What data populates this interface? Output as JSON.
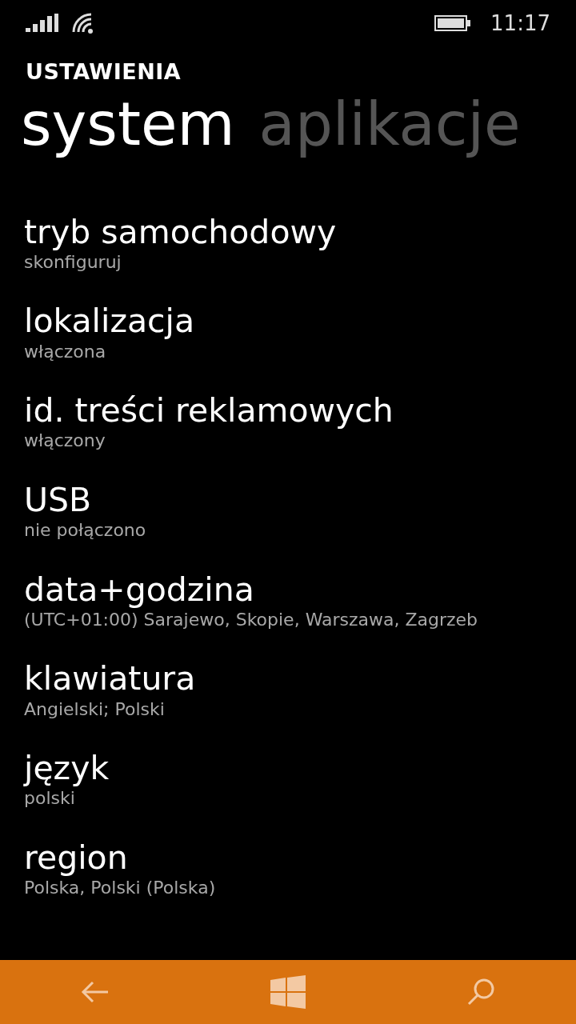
{
  "status_bar": {
    "time": "11:17"
  },
  "app_title": "USTAWIENIA",
  "pivots": [
    {
      "label": "system",
      "selected": true
    },
    {
      "label": "aplikacje",
      "selected": false
    }
  ],
  "settings": [
    {
      "title": "tryb samochodowy",
      "subtitle": "skonfiguruj"
    },
    {
      "title": "lokalizacja",
      "subtitle": "włączona"
    },
    {
      "title": "id. treści reklamowych",
      "subtitle": "włączony"
    },
    {
      "title": "USB",
      "subtitle": "nie połączono"
    },
    {
      "title": "data+godzina",
      "subtitle": "(UTC+01:00) Sarajewo, Skopie, Warszawa, Zagrzeb"
    },
    {
      "title": "klawiatura",
      "subtitle": "Angielski; Polski"
    },
    {
      "title": "język",
      "subtitle": "polski"
    },
    {
      "title": "region",
      "subtitle": "Polska, Polski (Polska)"
    }
  ]
}
